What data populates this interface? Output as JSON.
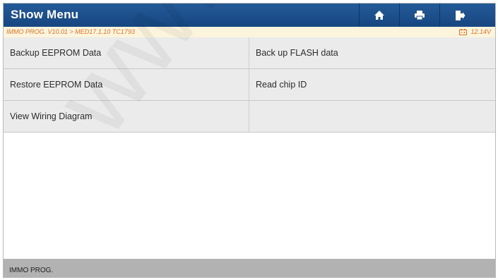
{
  "header": {
    "title": "Show Menu",
    "buttons": [
      {
        "icon": "home-icon"
      },
      {
        "icon": "print-icon"
      },
      {
        "icon": "exit-icon"
      }
    ],
    "color": "#1b4f8c"
  },
  "subbar": {
    "breadcrumb": "IMMO PROG. V10.01 > MED17.1.10 TC1793",
    "voltage": "12.14V",
    "voltage_icon": "battery-icon",
    "text_color": "#e2742c"
  },
  "menu": {
    "items": [
      "Backup EEPROM Data",
      "Back up FLASH data",
      "Restore EEPROM Data",
      "Read chip ID",
      "View Wiring Diagram"
    ]
  },
  "footer": {
    "text": "IMMO PROG."
  },
  "watermark": {
    "text": "www.launch"
  }
}
